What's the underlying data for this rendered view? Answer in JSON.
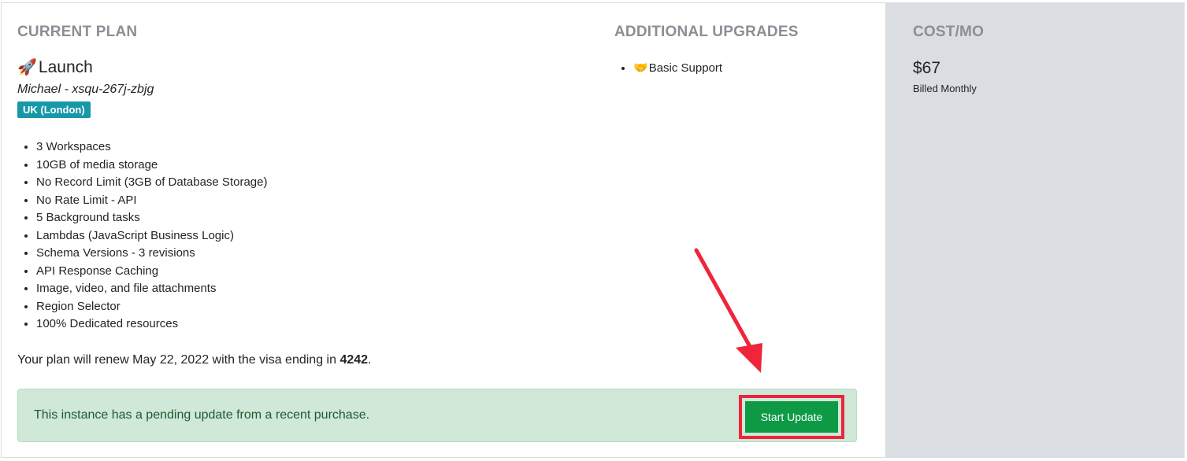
{
  "current_plan": {
    "heading": "CURRENT PLAN",
    "icon": "rocket-icon",
    "name": "Launch",
    "instance": "Michael - xsqu-267j-zbjg",
    "region": "UK (London)",
    "features": [
      "3 Workspaces",
      "10GB of media storage",
      "No Record Limit (3GB of Database Storage)",
      "No Rate Limit - API",
      "5 Background tasks",
      "Lambdas (JavaScript Business Logic)",
      "Schema Versions - 3 revisions",
      "API Response Caching",
      "Image, video, and file attachments",
      "Region Selector",
      "100% Dedicated resources"
    ],
    "renew_prefix": "Your plan will renew May 22, 2022 with the visa ending in ",
    "card_last4": "4242",
    "renew_suffix": "."
  },
  "alert": {
    "message": "This instance has a pending update from a recent purchase.",
    "button_label": "Start Update"
  },
  "upgrades": {
    "heading": "ADDITIONAL UPGRADES",
    "items": [
      {
        "icon": "handshake-icon",
        "label": "Basic Support"
      }
    ]
  },
  "cost": {
    "heading": "COST/MO",
    "price": "$67",
    "billing": "Billed Monthly"
  },
  "colors": {
    "region_badge": "#1798a9",
    "alert_bg": "#cfe8d7",
    "button_bg": "#0e9a44",
    "highlight": "#f0243a",
    "cost_panel_bg": "#dadde1"
  }
}
